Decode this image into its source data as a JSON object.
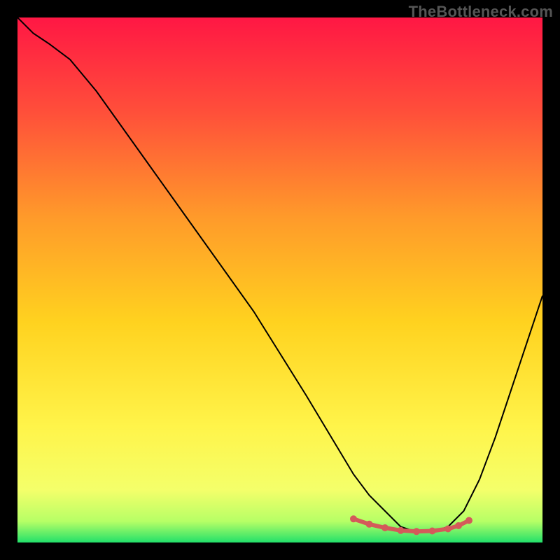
{
  "watermark": "TheBottleneck.com",
  "colors": {
    "marker": "#d45a5a",
    "curve": "#000000",
    "gradient_stops": [
      {
        "offset": "0%",
        "color": "#ff1744"
      },
      {
        "offset": "18%",
        "color": "#ff4f3a"
      },
      {
        "offset": "38%",
        "color": "#ff9a2a"
      },
      {
        "offset": "58%",
        "color": "#ffd21f"
      },
      {
        "offset": "78%",
        "color": "#fff44a"
      },
      {
        "offset": "90%",
        "color": "#f4ff6a"
      },
      {
        "offset": "96%",
        "color": "#b6ff66"
      },
      {
        "offset": "100%",
        "color": "#22e06a"
      }
    ]
  },
  "chart_data": {
    "type": "line",
    "title": "",
    "xlabel": "",
    "ylabel": "",
    "x_range": [
      0,
      100
    ],
    "y_range": [
      0,
      100
    ],
    "note": "x and y are normalized 0-100 across the plot area; y=100 is top, y=0 is bottom valley. Values are estimated from the rendered curve.",
    "series": [
      {
        "name": "bottleneck_curve",
        "x": [
          0,
          3,
          6,
          10,
          15,
          20,
          25,
          30,
          35,
          40,
          45,
          50,
          55,
          58,
          61,
          64,
          67,
          70,
          73,
          76,
          79,
          82,
          85,
          88,
          91,
          94,
          97,
          100
        ],
        "y": [
          100,
          97,
          95,
          92,
          86,
          79,
          72,
          65,
          58,
          51,
          44,
          36,
          28,
          23,
          18,
          13,
          9,
          6,
          3,
          2,
          2,
          3,
          6,
          12,
          20,
          29,
          38,
          47
        ]
      }
    ],
    "markers": {
      "name": "sweet_spot",
      "x": [
        64,
        67,
        70,
        73,
        76,
        79,
        82,
        84,
        86
      ],
      "y": [
        4.5,
        3.5,
        2.8,
        2.3,
        2.1,
        2.2,
        2.6,
        3.2,
        4.2
      ]
    }
  }
}
